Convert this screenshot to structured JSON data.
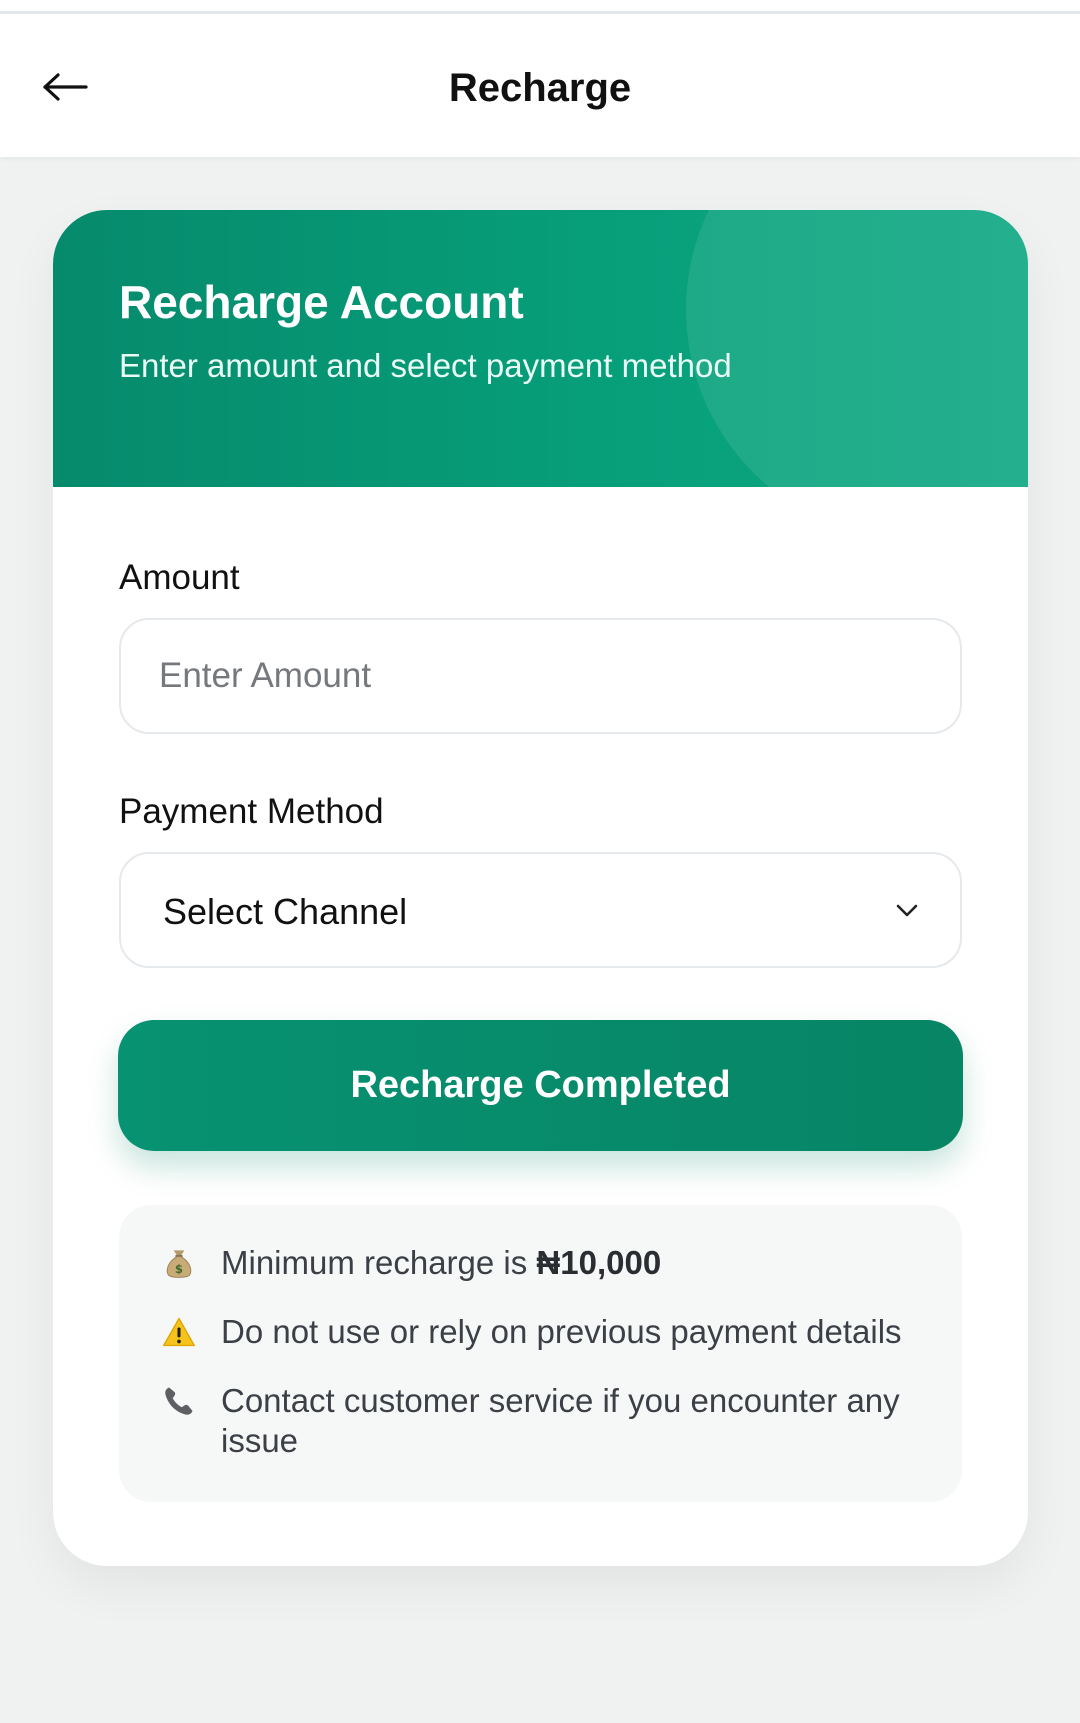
{
  "header": {
    "title": "Recharge",
    "back_icon": "arrow-left-icon"
  },
  "hero": {
    "title": "Recharge Account",
    "subtitle": "Enter amount and select payment method",
    "colors": {
      "start": "#068a6c",
      "end": "#0fa983"
    }
  },
  "form": {
    "amount_label": "Amount",
    "amount_value": "",
    "amount_placeholder": "Enter Amount",
    "method_label": "Payment Method",
    "method_value": "Select Channel",
    "submit_label": "Recharge Completed"
  },
  "notes": [
    {
      "icon": "money-bag-icon",
      "text": "Minimum recharge is ",
      "strong": "₦10,000"
    },
    {
      "icon": "warning-icon",
      "text": "Do not use or rely on previous payment details"
    },
    {
      "icon": "phone-icon",
      "text": "Contact customer service if you encounter any issue"
    }
  ],
  "colors": {
    "accent": "#078565",
    "background": "#eff2f1"
  }
}
